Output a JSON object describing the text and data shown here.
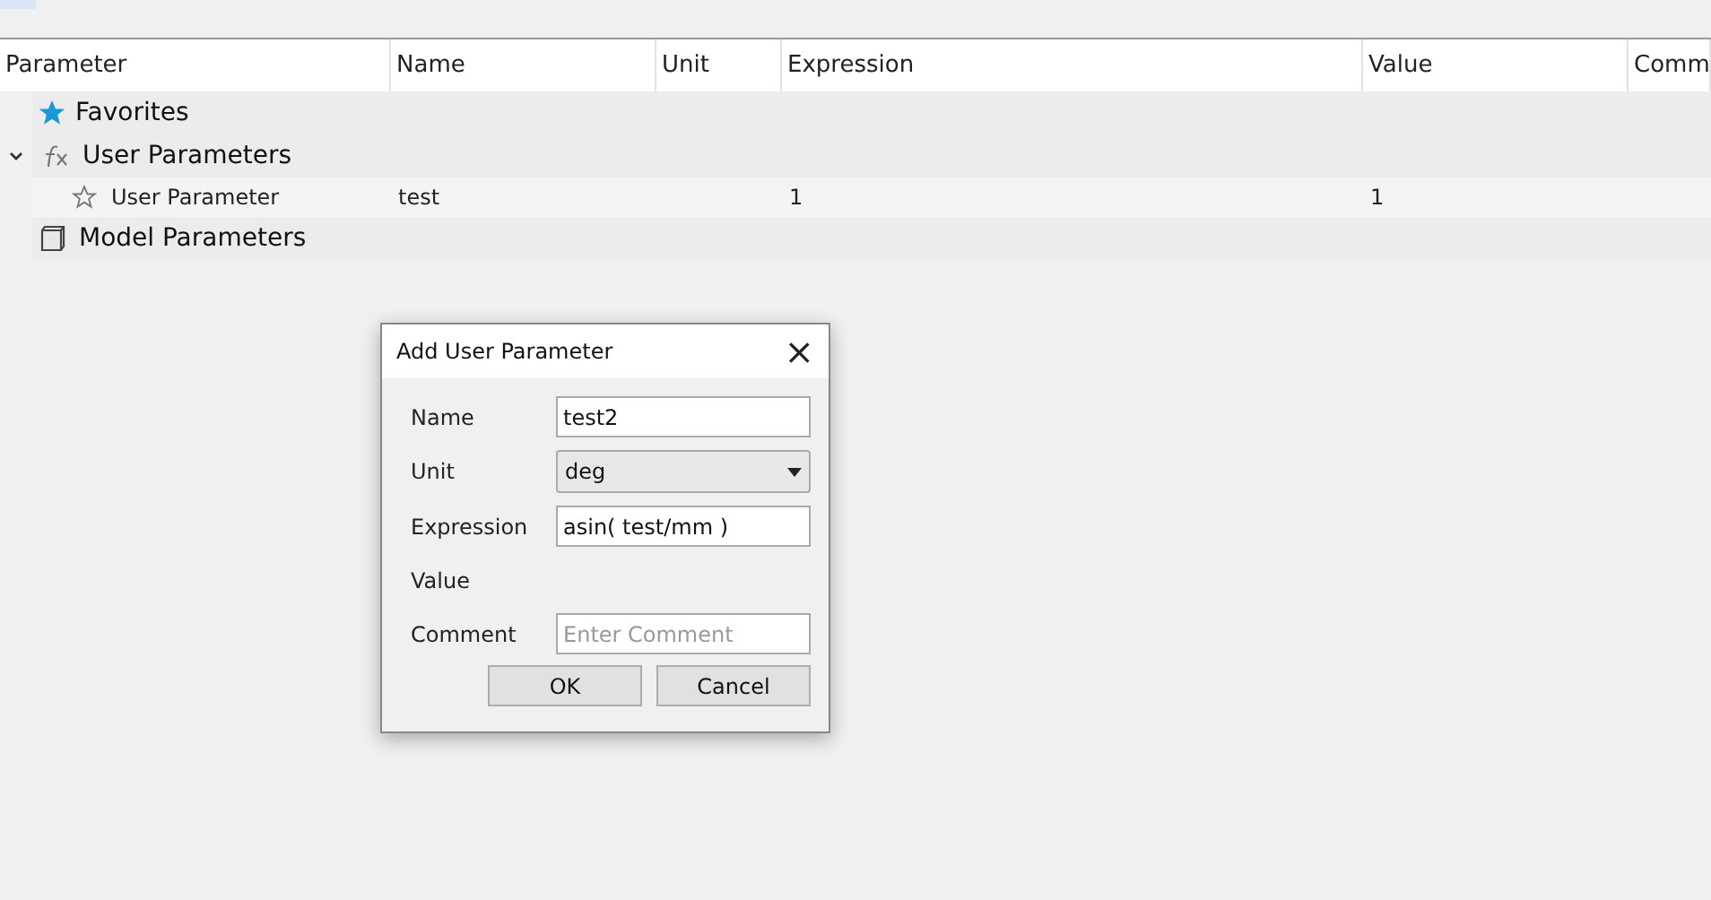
{
  "table": {
    "columns": [
      "Parameter",
      "Name",
      "Unit",
      "Expression",
      "Value",
      "Comm"
    ],
    "rows": [
      {
        "label": "Favorites",
        "kind": "group"
      },
      {
        "label": "User Parameters",
        "kind": "group",
        "expanded": true,
        "children": [
          {
            "label": "User Parameter",
            "kind": "parameter",
            "favorite": false,
            "cells": [
              "test",
              "",
              "1",
              "1",
              ""
            ]
          }
        ]
      },
      {
        "label": "Model Parameters",
        "kind": "group"
      }
    ]
  },
  "dialog": {
    "title": "Add User Parameter",
    "close": "×",
    "fields": [
      {
        "label": "Name",
        "kind": "text",
        "value": "test2"
      },
      {
        "label": "Unit",
        "kind": "select",
        "value": "deg"
      },
      {
        "label": "Expression",
        "kind": "text",
        "value": "asin( test/mm )"
      },
      {
        "label": "Value",
        "kind": "static"
      },
      {
        "label": "Comment",
        "kind": "text",
        "placeholder": "Enter Comment"
      }
    ],
    "buttons": [
      "OK",
      "Cancel"
    ]
  }
}
